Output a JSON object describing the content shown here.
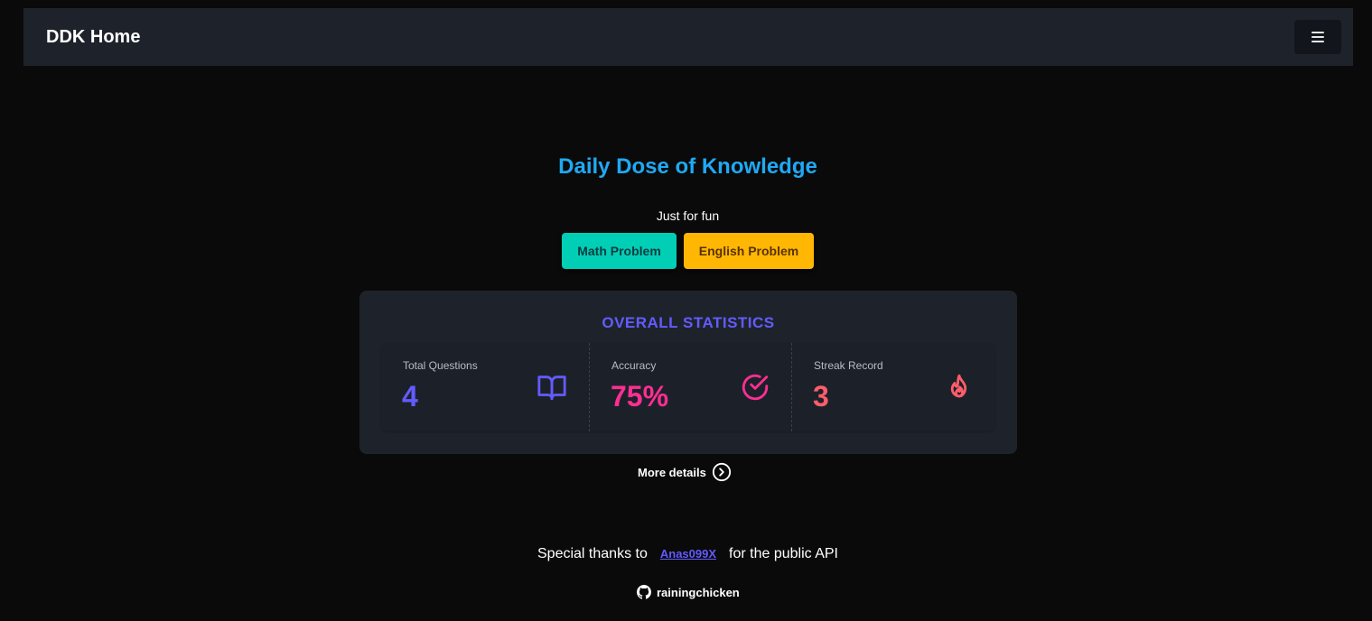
{
  "navbar": {
    "brand": "DDK Home",
    "menu_icon": "hamburger-menu-icon"
  },
  "hero": {
    "title": "Daily Dose of Knowledge",
    "subtitle": "Just for fun",
    "math_button": "Math Problem",
    "english_button": "English Problem"
  },
  "stats": {
    "title": "OVERALL STATISTICS",
    "items": [
      {
        "label": "Total Questions",
        "value": "4",
        "icon": "book-open-icon"
      },
      {
        "label": "Accuracy",
        "value": "75%",
        "icon": "check-circle-icon"
      },
      {
        "label": "Streak Record",
        "value": "3",
        "icon": "flame-icon"
      }
    ]
  },
  "more_details": {
    "label": "More details",
    "icon": "chevron-right-circle-icon"
  },
  "footer": {
    "thanks_prefix": "Special thanks to",
    "author_link": "Anas099X",
    "thanks_suffix": "for the public API",
    "github_user": "rainingchicken",
    "github_icon": "github-icon"
  },
  "colors": {
    "background": "#0a0a0a",
    "navbar": "#1e232b",
    "title_blue": "#1fa9f5",
    "math_teal": "#00cfb6",
    "english_amber": "#ffb703",
    "purple": "#635bff",
    "pink": "#ff2e93",
    "coral": "#ff5d6b"
  }
}
